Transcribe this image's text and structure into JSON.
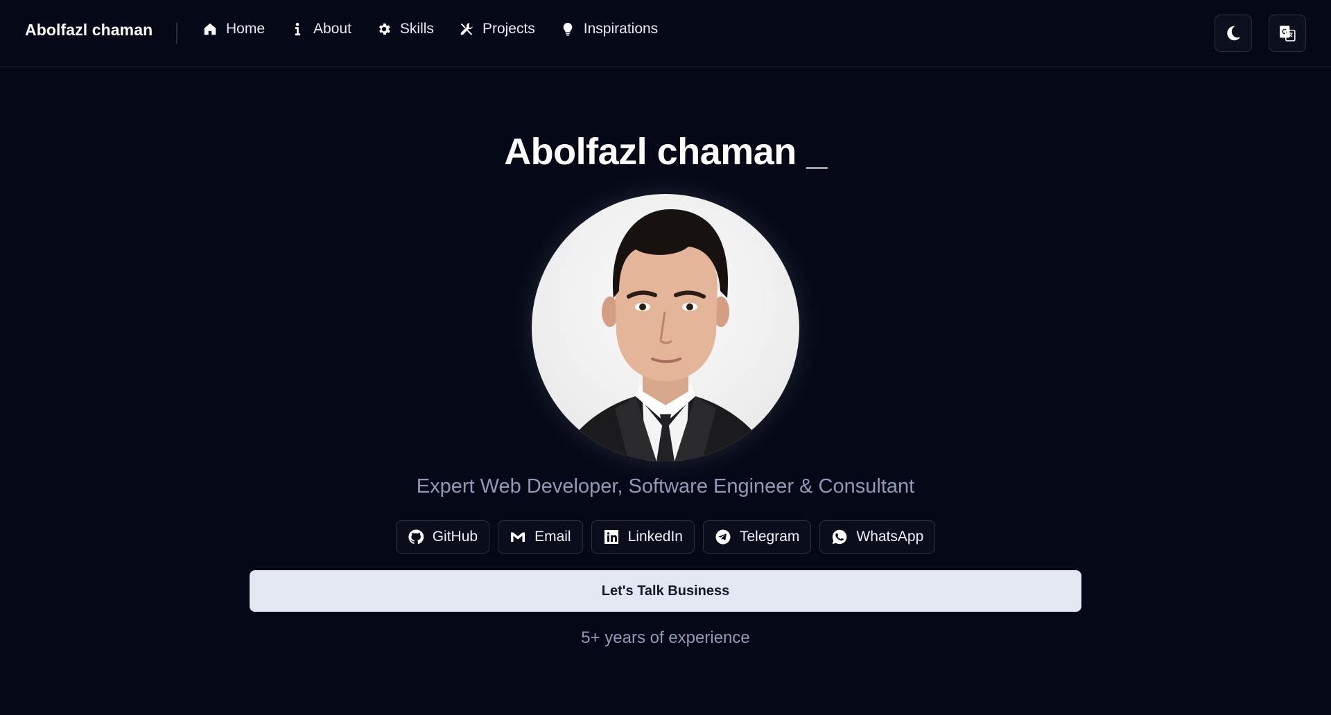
{
  "nav": {
    "brand": "Abolfazl chaman",
    "links": [
      {
        "label": "Home",
        "icon": "home-icon"
      },
      {
        "label": "About",
        "icon": "info-icon"
      },
      {
        "label": "Skills",
        "icon": "gear-icon"
      },
      {
        "label": "Projects",
        "icon": "tools-icon"
      },
      {
        "label": "Inspirations",
        "icon": "lightbulb-icon"
      }
    ],
    "actions": {
      "theme_icon": "moon-icon",
      "language_icon": "translate-icon"
    }
  },
  "hero": {
    "title": "Abolfazl chaman _",
    "avatar": "profile-photo",
    "subtitle": "Expert Web Developer, Software Engineer & Consultant",
    "socials": [
      {
        "label": "GitHub",
        "icon": "github-icon"
      },
      {
        "label": "Email",
        "icon": "gmail-icon"
      },
      {
        "label": "LinkedIn",
        "icon": "linkedin-icon"
      },
      {
        "label": "Telegram",
        "icon": "telegram-icon"
      },
      {
        "label": "WhatsApp",
        "icon": "whatsapp-icon"
      }
    ],
    "cta_label": "Let's Talk Business",
    "experience": "5+ years of experience"
  },
  "colors": {
    "background": "#050816",
    "cta_background": "#e3e7f1",
    "muted_text": "#8f9ab8"
  }
}
